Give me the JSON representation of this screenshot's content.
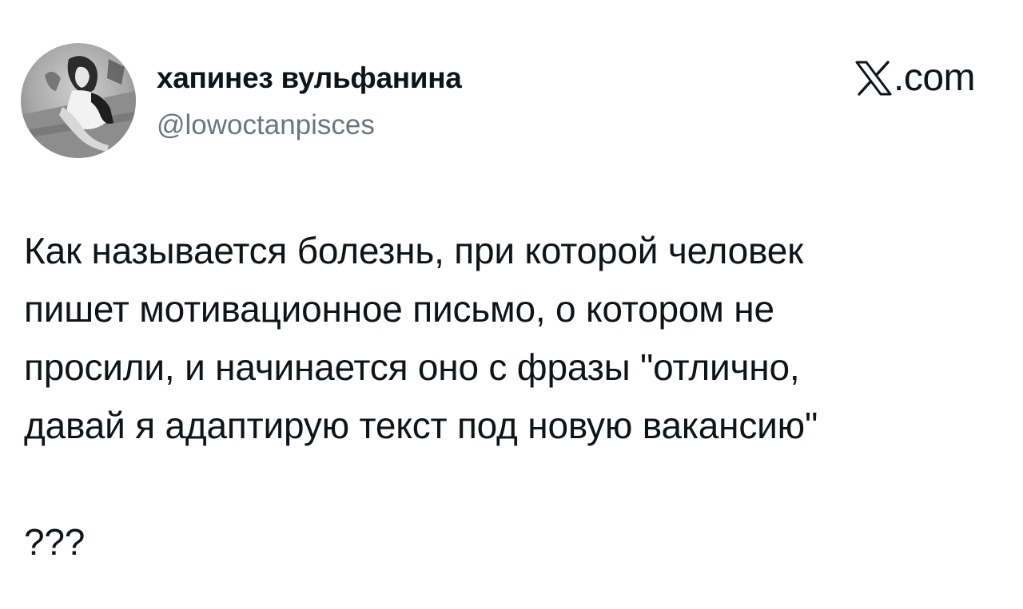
{
  "author": {
    "display_name": "хапинез вульфанина",
    "handle": "@lowoctanpisces",
    "avatar_icon": "profile-photo"
  },
  "brand": {
    "icon": "x-logo-icon",
    "text": ".com"
  },
  "tweet": {
    "text": "Как называется болезнь, при которой человек\nпишет мотивационное письмо, о котором не\nпросили, и начинается оно с фразы \"отлично,\nдавай я адаптирую текст под новую вакансию\"\n\n???"
  },
  "colors": {
    "text": "#0f1419",
    "secondary": "#6b7680",
    "background": "#ffffff"
  }
}
